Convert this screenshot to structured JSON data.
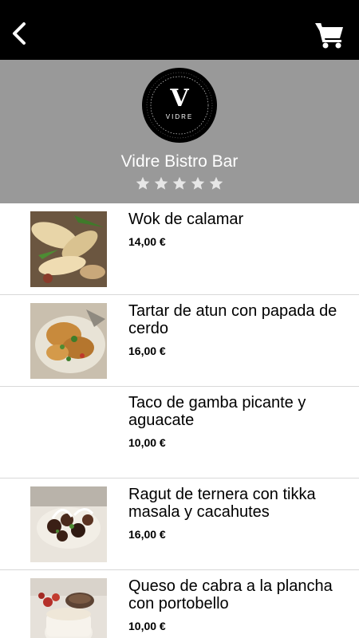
{
  "header": {
    "back_icon": "chevron-left-icon",
    "cart_icon": "shopping-cart-icon"
  },
  "restaurant": {
    "logo_letter": "V",
    "logo_word": "VIDRE",
    "name": "Vidre Bistro Bar",
    "rating": 0,
    "max_rating": 5,
    "hero_color": "#999999"
  },
  "dishes": [
    {
      "name": "Wok de calamar",
      "price": "14,00 €",
      "has_image": true
    },
    {
      "name": "Tartar de atun con papada de cerdo",
      "price": "16,00 €",
      "has_image": true
    },
    {
      "name": "Taco de gamba picante y aguacate",
      "price": "10,00 €",
      "has_image": false
    },
    {
      "name": "Ragut de ternera con tikka masala y cacahutes",
      "price": "16,00 €",
      "has_image": true
    },
    {
      "name": "Queso de cabra a la plancha con portobello",
      "price": "10,00 €",
      "has_image": true
    }
  ]
}
